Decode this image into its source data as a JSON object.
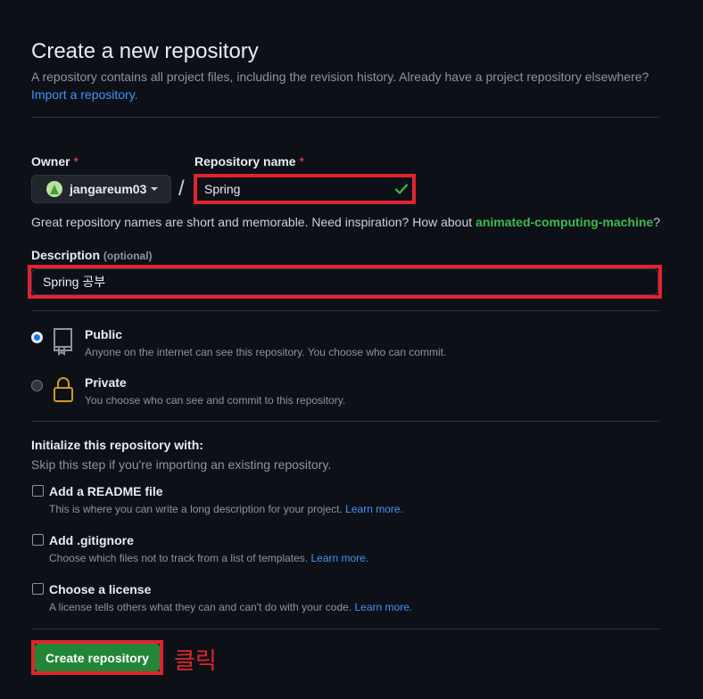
{
  "header": {
    "title": "Create a new repository",
    "subtitle": "A repository contains all project files, including the revision history. Already have a project repository elsewhere?",
    "import_link": "Import a repository."
  },
  "owner": {
    "label": "Owner",
    "required_mark": "*",
    "value": "jangareum03"
  },
  "separator": "/",
  "repo_name": {
    "label": "Repository name",
    "required_mark": "*",
    "value": "Spring",
    "valid": true
  },
  "name_hint": {
    "text_before": "Great repository names are short and memorable. Need inspiration? How about ",
    "suggestion": "animated-computing-machine",
    "text_after": "?"
  },
  "description": {
    "label": "Description",
    "optional": "(optional)",
    "value": "Spring 공부"
  },
  "visibility": {
    "selected": "Public",
    "options": [
      {
        "title": "Public",
        "desc": "Anyone on the internet can see this repository. You choose who can commit.",
        "icon": "repo-icon"
      },
      {
        "title": "Private",
        "desc": "You choose who can see and commit to this repository.",
        "icon": "lock-icon"
      }
    ]
  },
  "initialize": {
    "title": "Initialize this repository with:",
    "subtitle": "Skip this step if you're importing an existing repository.",
    "options": [
      {
        "title": "Add a README file",
        "desc": "This is where you can write a long description for your project.",
        "link": "Learn more.",
        "checked": false
      },
      {
        "title": "Add .gitignore",
        "desc": "Choose which files not to track from a list of templates.",
        "link": "Learn more.",
        "checked": false
      },
      {
        "title": "Choose a license",
        "desc": "A license tells others what they can and can't do with your code.",
        "link": "Learn more.",
        "checked": false
      }
    ]
  },
  "create_button": "Create repository",
  "annotation": "클릭",
  "colors": {
    "background": "#0d1117",
    "accent_green": "#238636",
    "link_blue": "#4493f8",
    "highlight_red": "#e0242f",
    "suggestion_green": "#3fb950"
  }
}
